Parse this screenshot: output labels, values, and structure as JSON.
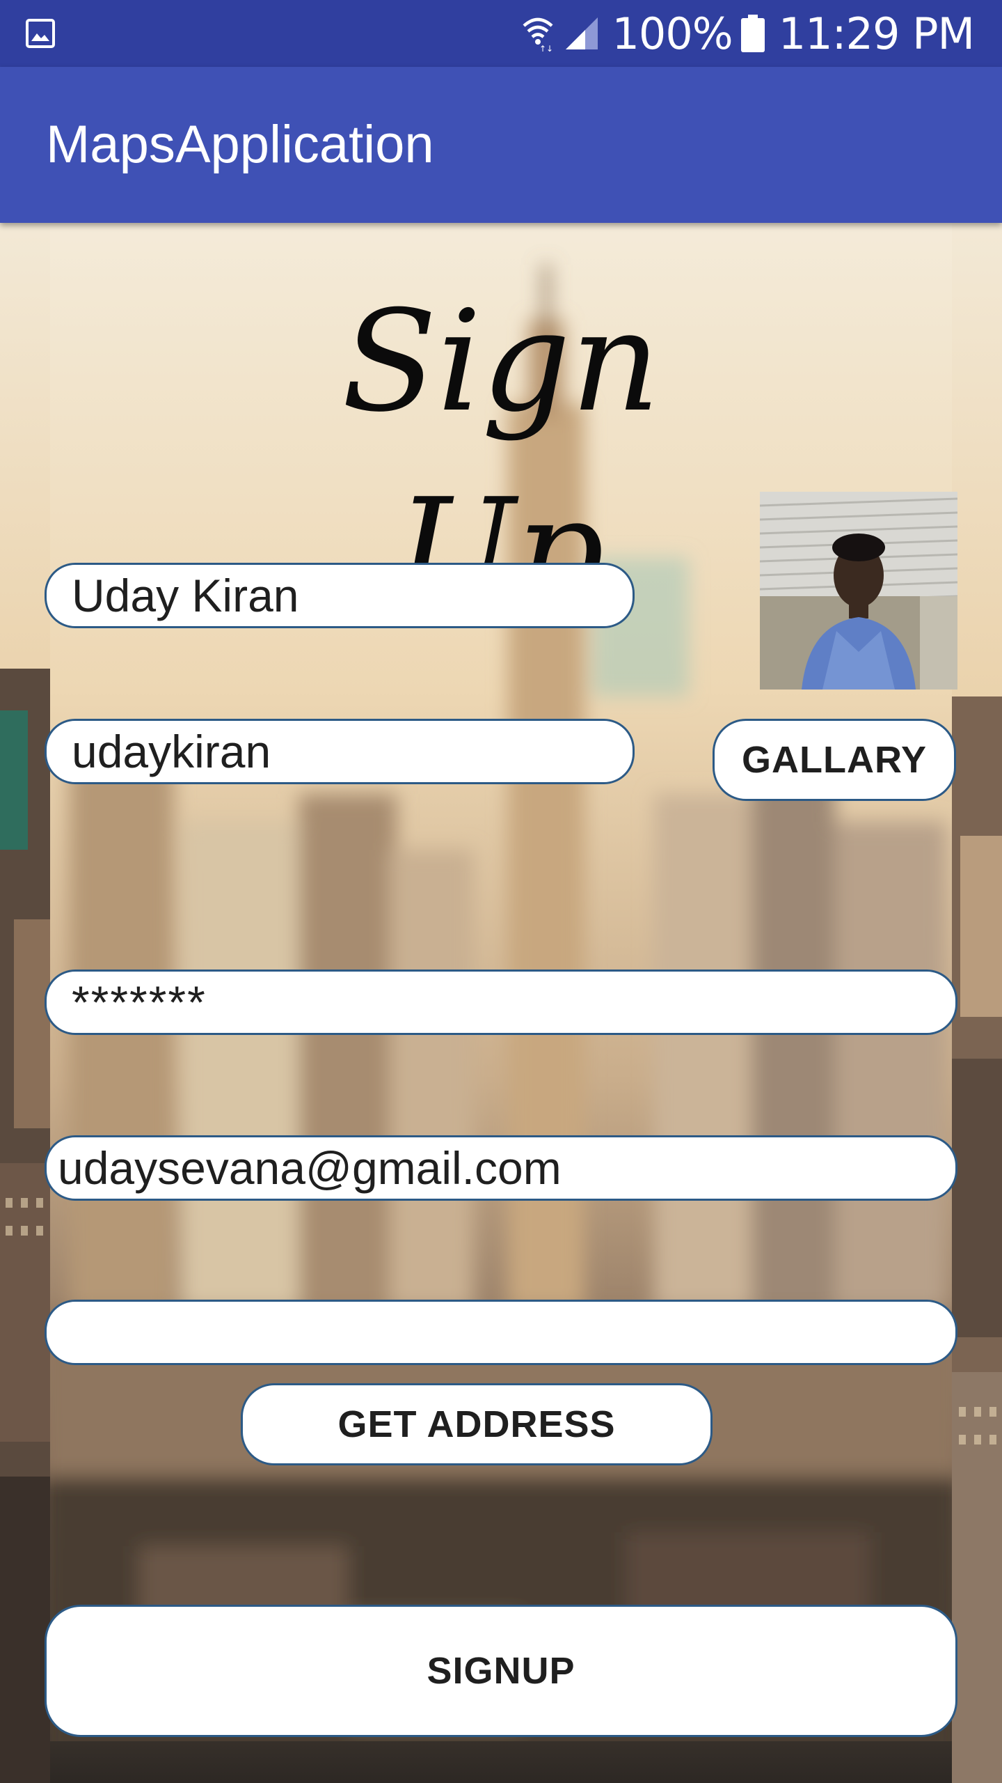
{
  "status_bar": {
    "battery_percent": "100%",
    "time": "11:29 PM",
    "icons": [
      "gallery-notification-icon",
      "wifi-icon",
      "signal-icon",
      "battery-icon"
    ]
  },
  "app_bar": {
    "title": "MapsApplication"
  },
  "form": {
    "heading": "Sign Up",
    "name_value": "Uday Kiran",
    "username_value": "udaykiran",
    "password_value": "*******",
    "email_value": "udaysevana@gmail.com",
    "address_value": "",
    "gallery_label": "GALLARY",
    "get_address_label": "GET ADDRESS",
    "signup_label": "SIGNUP"
  },
  "colors": {
    "status_bar": "#303f9f",
    "app_bar": "#3f51b5",
    "field_border": "#2c5a86"
  }
}
